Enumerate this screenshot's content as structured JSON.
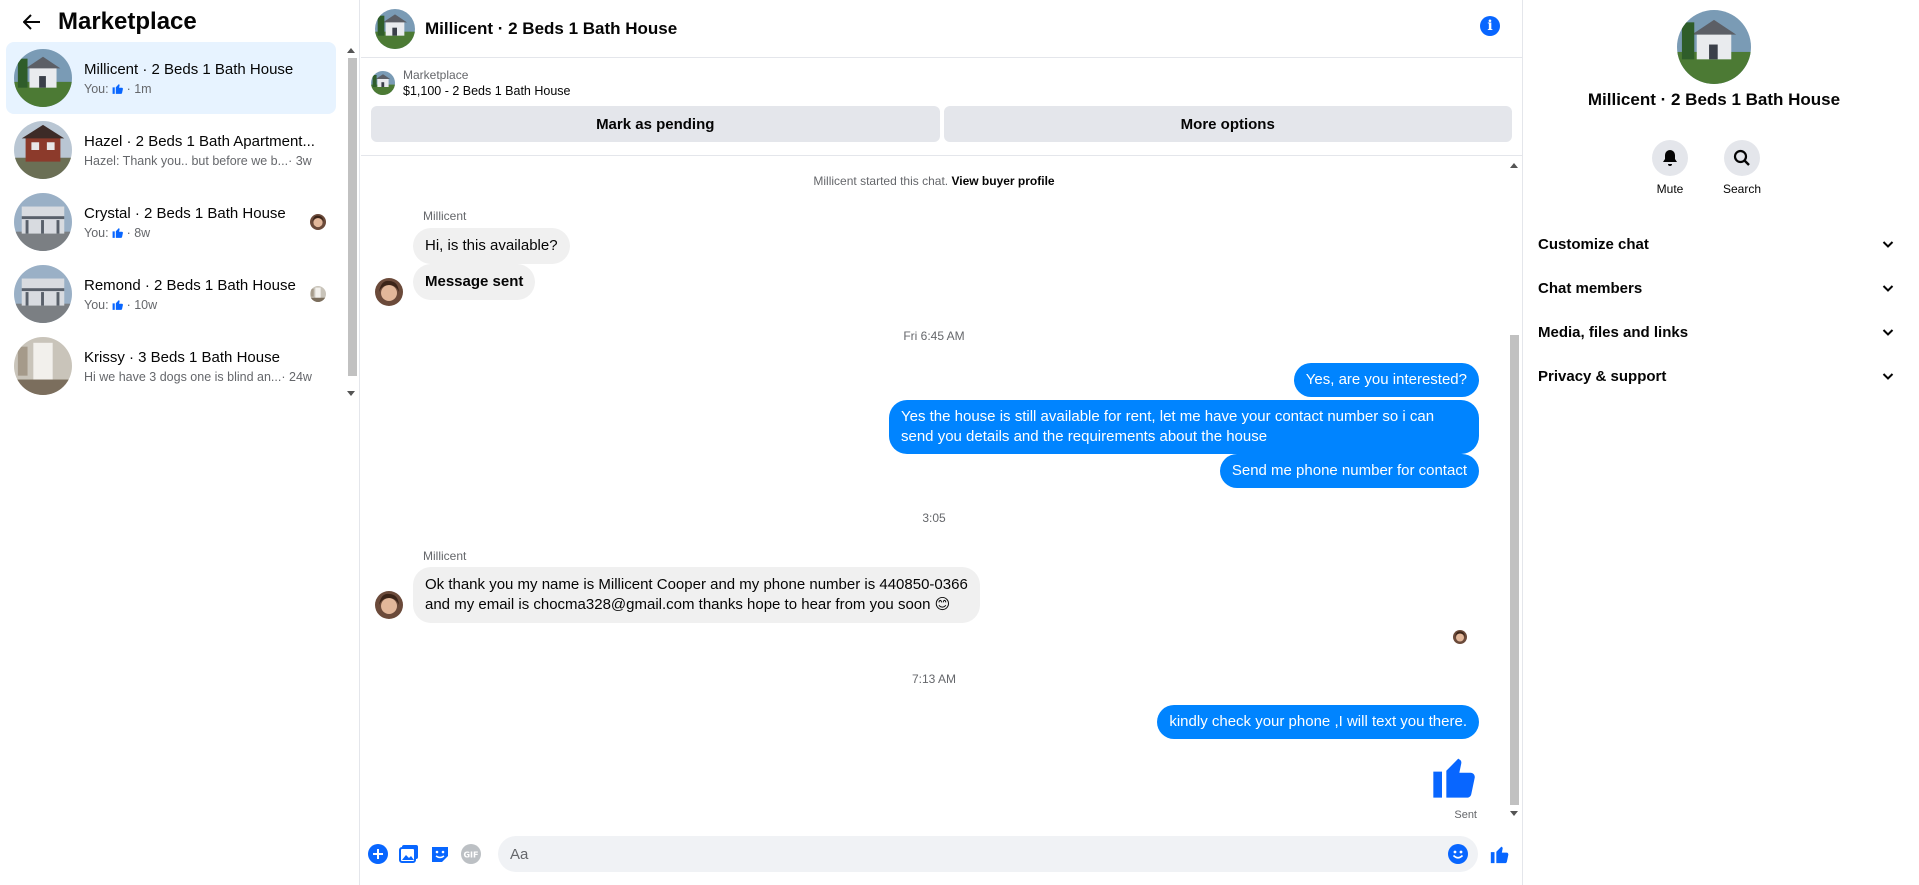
{
  "sidebar": {
    "title": "Marketplace",
    "conversations": [
      {
        "title": "Millicent · 2 Beds 1 Bath House",
        "prefix": "You:",
        "time": "· 1m",
        "has_like": true,
        "active": true
      },
      {
        "title": "Hazel · 2 Beds 1 Bath Apartment...",
        "prefix": "Hazel: Thank you.. but before we b...",
        "time": "· 3w",
        "has_like": false,
        "active": false
      },
      {
        "title": "Crystal · 2 Beds 1 Bath House",
        "prefix": "You:",
        "time": "· 8w",
        "has_like": true,
        "active": false
      },
      {
        "title": "Remond · 2 Beds 1 Bath House",
        "prefix": "You:",
        "time": "· 10w",
        "has_like": true,
        "active": false
      },
      {
        "title": "Krissy · 3 Beds 1 Bath House",
        "prefix": "Hi we have 3 dogs one is blind an...",
        "time": "· 24w",
        "has_like": false,
        "active": false
      }
    ]
  },
  "chat": {
    "title": "Millicent · 2 Beds 1 Bath House",
    "listing": {
      "source": "Marketplace",
      "price_title": "$1,100 - 2 Beds 1 Bath House",
      "pending_button": "Mark as pending",
      "more_button": "More options"
    },
    "system": {
      "started": "Millicent started this chat.",
      "profile_link": "View buyer profile"
    },
    "sender": "Millicent",
    "incoming_1": "Hi, is this available?",
    "incoming_2": "Message sent",
    "time_1": "Fri 6:45 AM",
    "outgoing_1": "Yes, are you interested?",
    "outgoing_2": "Yes the house is still available for rent, let me have your contact number so i can send you details and the requirements about the house",
    "outgoing_3": "Send me phone number for contact",
    "time_2": "3:05",
    "incoming_3_line1": "Ok thank you my name is Millicent Cooper and my phone number is 440850-0366",
    "incoming_3_line2": "and my email is chocma328@gmail.com thanks hope to hear from you soon 😊",
    "time_3": "7:13 AM",
    "outgoing_4": "kindly check your phone ,I will text you there.",
    "status": "Sent",
    "composer_placeholder": "Aa"
  },
  "right_panel": {
    "title": "Millicent · 2 Beds 1 Bath House",
    "mute_label": "Mute",
    "search_label": "Search",
    "sections": [
      "Customize chat",
      "Chat members",
      "Media, files and links",
      "Privacy & support"
    ]
  },
  "colors": {
    "accent": "#0084ff",
    "active_bg": "#e7f3ff",
    "incoming_bubble": "#f0f0f0",
    "muted_text": "#65676b"
  },
  "icons": {
    "back": "arrow-left-icon",
    "info": "info-icon",
    "like": "thumbs-up-icon",
    "mute": "bell-icon",
    "search": "search-icon",
    "expand": "chevron-down-icon",
    "plus": "plus-circle-icon",
    "photo": "photo-icon",
    "sticker": "sticker-icon",
    "gif": "gif-icon",
    "emoji": "emoji-icon"
  }
}
